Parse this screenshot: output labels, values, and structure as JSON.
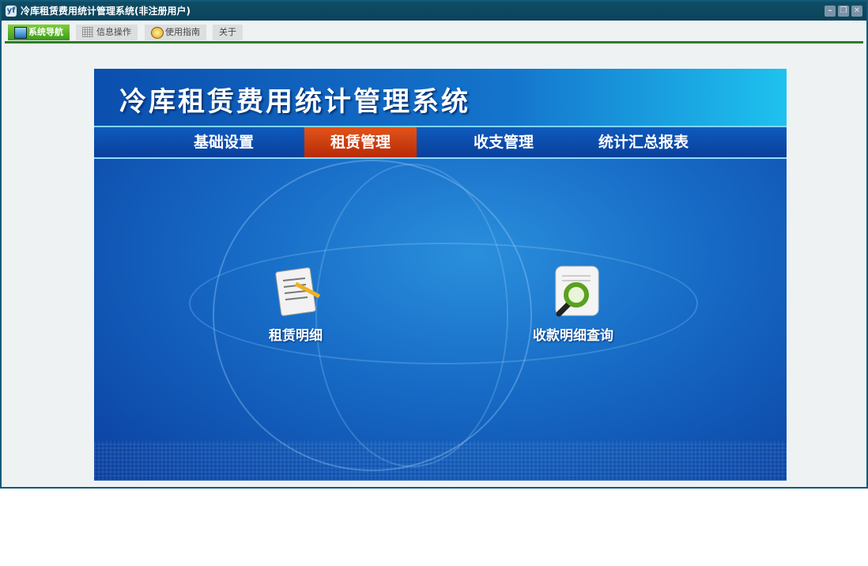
{
  "window": {
    "title": "冷库租赁费用统计管理系统(非注册用户)",
    "icon": "yf-app-icon"
  },
  "toolbar": {
    "tabs": [
      {
        "label": "系统导航",
        "icon": "monitor-icon",
        "active": true
      },
      {
        "label": "信息操作",
        "icon": "grid-icon"
      },
      {
        "label": "使用指南",
        "icon": "help-icon"
      },
      {
        "label": "关于"
      }
    ]
  },
  "banner": {
    "title": "冷库租赁费用统计管理系统",
    "menu": [
      {
        "label": "基础设置"
      },
      {
        "label": "租赁管理",
        "active": true
      },
      {
        "label": "收支管理"
      },
      {
        "label": "统计汇总报表"
      }
    ],
    "items": [
      {
        "label": "租赁明细",
        "icon": "document-pencil-icon"
      },
      {
        "label": "收款明细查询",
        "icon": "document-magnifier-icon"
      }
    ]
  },
  "colors": {
    "active_menu": "#c8380c",
    "active_tab": "#5cb52a",
    "frame": "#0f4e66"
  }
}
